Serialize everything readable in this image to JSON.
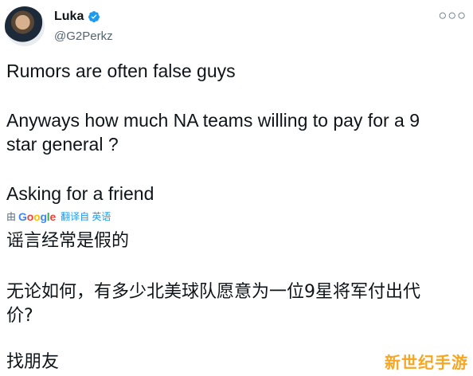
{
  "author": {
    "display_name": "Luka",
    "handle": "@G2Perkz",
    "verified": true
  },
  "more_icon": "more-horizontal-icon",
  "tweet_lines": {
    "line1": "Rumors are often false guys",
    "line2": "Anyways how much NA teams willing to pay for a 9",
    "line3": "star general ?",
    "line4": "Asking for a friend"
  },
  "translation_bar": {
    "prefix": "由",
    "provider": "Google",
    "suffix": "翻译自 英语"
  },
  "translated_lines": {
    "line1": "谣言经常是假的",
    "line2": "无论如何，有多少北美球队愿意为一位9星将军付出代",
    "line3": "价?",
    "line4": "找朋友"
  },
  "watermark": "新世纪手游",
  "colors": {
    "text": "#0f1419",
    "muted": "#536471",
    "link": "#1d9bf0",
    "verified": "#1d9bf0",
    "watermark": "#f5a623"
  }
}
